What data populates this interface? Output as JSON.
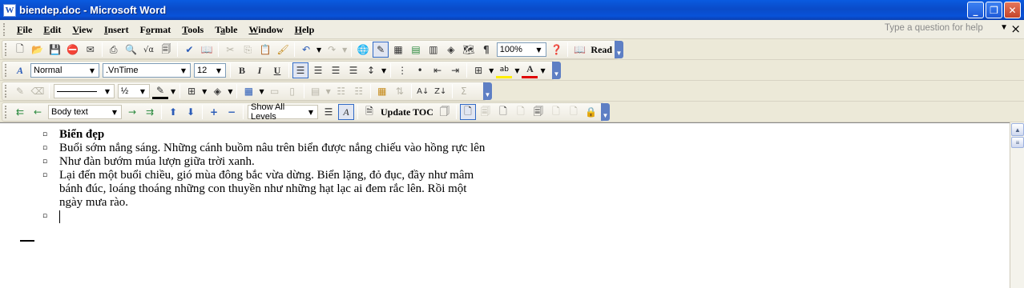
{
  "window": {
    "title": "biendep.doc - Microsoft Word",
    "app_icon_letter": "W",
    "minimize": "_",
    "restore": "❐",
    "close": "✕"
  },
  "menubar": {
    "items": [
      {
        "label": "File",
        "ul": "F",
        "rest": "ile"
      },
      {
        "label": "Edit",
        "ul": "E",
        "rest": "dit"
      },
      {
        "label": "View",
        "ul": "V",
        "rest": "iew"
      },
      {
        "label": "Insert",
        "ul": "I",
        "rest": "nsert"
      },
      {
        "label": "Format",
        "ul": "o",
        "pre": "F",
        "rest": "rmat"
      },
      {
        "label": "Tools",
        "ul": "T",
        "rest": "ools"
      },
      {
        "label": "Table",
        "ul": "a",
        "pre": "T",
        "rest": "ble"
      },
      {
        "label": "Window",
        "ul": "W",
        "rest": "indow"
      },
      {
        "label": "Help",
        "ul": "H",
        "rest": "elp"
      }
    ],
    "help_placeholder": "Type a question for help",
    "doc_close": "×"
  },
  "standard_toolbar": {
    "zoom": "100%",
    "read_label": "Read"
  },
  "formatting_toolbar": {
    "style": "Normal",
    "font": ".VnTime",
    "size": "12",
    "bold": "B",
    "italic": "I",
    "underline": "U"
  },
  "drawing_toolbar": {
    "line_weight": "½"
  },
  "outline_toolbar": {
    "level": "Body text",
    "show_levels": "Show All Levels",
    "update_toc": "Update TOC"
  },
  "document": {
    "items": [
      {
        "text": "Biển đẹp",
        "bold": true
      },
      {
        "text": "Buổi sớm nắng sáng. Những cánh buồm nâu trên biển được nắng chiếu vào hồng rực lên"
      },
      {
        "text": "Như đàn bướm múa lượn giữa trời xanh."
      },
      {
        "text": "Lại đến một buổi chiều, gió mùa đông bắc vừa dừng. Biển lặng, đỏ đục, đầy như mâm bánh đúc, loáng thoáng những con thuyền như những hạt lạc ai đem rắc lên. Rồi một ngày mưa rào."
      },
      {
        "text": ""
      }
    ]
  }
}
